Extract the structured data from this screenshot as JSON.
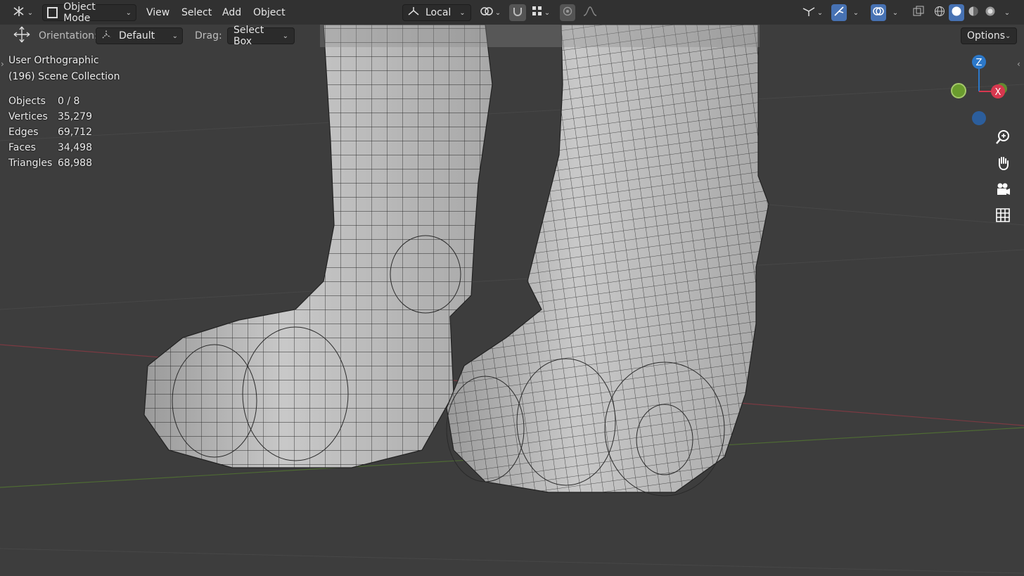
{
  "header": {
    "mode": "Object Mode",
    "menus": [
      "View",
      "Select",
      "Add",
      "Object"
    ],
    "transform_pivot": "Local",
    "options_label": "Options"
  },
  "toolbar": {
    "orientation_label": "Orientation:",
    "orientation_value": "Default",
    "drag_label": "Drag:",
    "drag_value": "Select Box"
  },
  "overlay": {
    "view_name": "User Orthographic",
    "collection": "(196) Scene Collection"
  },
  "stats": [
    {
      "label": "Objects",
      "value": "0 / 8"
    },
    {
      "label": "Vertices",
      "value": "35,279"
    },
    {
      "label": "Edges",
      "value": "69,712"
    },
    {
      "label": "Faces",
      "value": "34,498"
    },
    {
      "label": "Triangles",
      "value": "68,988"
    }
  ],
  "gizmo": {
    "z": "Z",
    "x": "X"
  },
  "colors": {
    "background": "#3d3d3d",
    "axis_x": "#d7384f",
    "axis_y": "#6a9c2e",
    "axis_z": "#2c78c9",
    "active": "#4772b3"
  }
}
